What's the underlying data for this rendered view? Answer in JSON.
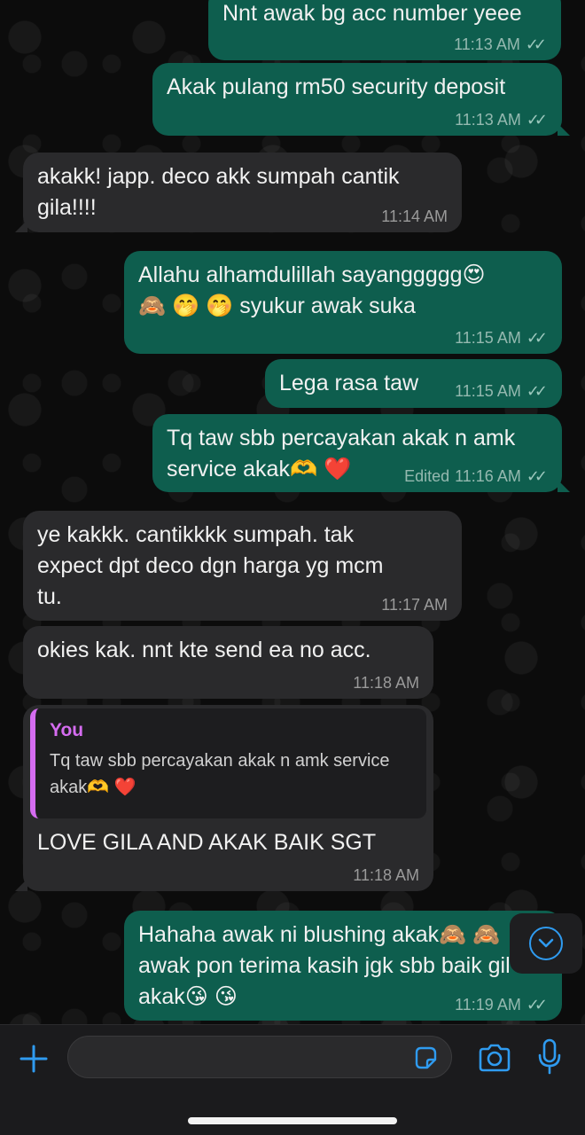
{
  "messages": [
    {
      "text": "Nnt awak bg acc number yeee",
      "time": "11:13 AM"
    },
    {
      "text": "Akak pulang rm50 security deposit",
      "time": "11:13 AM"
    },
    {
      "text": "akakk! japp. deco akk sumpah cantik\ngila!!!!",
      "time": "11:14 AM"
    },
    {
      "text": "Allahu alhamdulillah sayanggggg😍\n🙈 🤭 🤭 syukur awak suka",
      "time": "11:15 AM"
    },
    {
      "text": "Lega rasa taw",
      "time": "11:15 AM"
    },
    {
      "text": "Tq taw sbb percayakan akak n amk\nservice akak🫶 ❤️",
      "time": "11:16 AM",
      "edited": "Edited"
    },
    {
      "text": "ye kakkk. cantikkkk sumpah. tak\nexpect dpt deco dgn harga yg mcm\ntu.",
      "time": "11:17 AM"
    },
    {
      "text": "okies kak. nnt kte send ea no acc.",
      "time": "11:18 AM"
    },
    {
      "quote_author": "You",
      "quote_text": "Tq taw sbb percayakan akak n amk service\nakak🫶 ❤️",
      "text": "LOVE GILA AND AKAK BAIK SGT",
      "time": "11:18 AM"
    },
    {
      "text": "Hahaha awak ni blushing akak🙈 🙈\nawak pon terima kasih jgk sbb baik gil\nakak😘 😘",
      "time": "11:19 AM"
    }
  ],
  "colors": {
    "outgoing_bubble": "#0e5e4e",
    "incoming_bubble": "#2a2a2c",
    "quote_accent": "#d56cf0",
    "accent_blue": "#2f9bf0"
  },
  "icons": [
    "plus-icon",
    "sticker-icon",
    "camera-icon",
    "microphone-icon",
    "scroll-down-icon",
    "read-ticks-icon"
  ]
}
